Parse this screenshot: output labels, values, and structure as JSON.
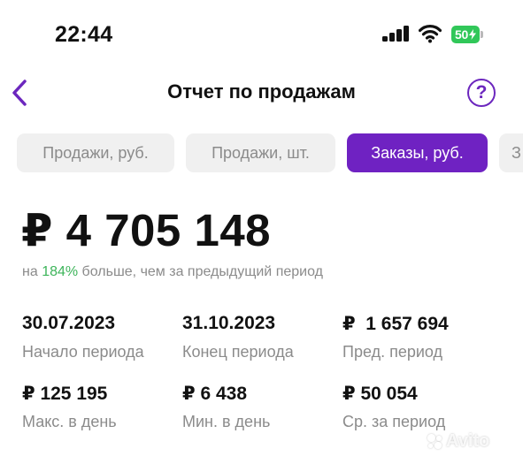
{
  "status_bar": {
    "time": "22:44",
    "battery_level": "50",
    "icons": [
      "signal-bars-icon",
      "wifi-icon",
      "battery-charging-icon"
    ]
  },
  "header": {
    "title": "Отчет по продажам",
    "back_icon": "chevron-left-icon",
    "help_label": "?",
    "accent_color": "#6c27be"
  },
  "tabs": [
    {
      "label": "Продажи, руб.",
      "active": false
    },
    {
      "label": "Продажи, шт.",
      "active": false
    },
    {
      "label": "Заказы, руб.",
      "active": true
    },
    {
      "label": "З",
      "active": false
    }
  ],
  "summary": {
    "total": "₽ 4 705 148",
    "compare_prefix": "на ",
    "compare_percent": "184%",
    "compare_suffix": " больше, чем за предыдущий период",
    "percent_color": "#3db45a"
  },
  "stats": [
    {
      "value": "30.07.2023",
      "caption": "Начало периода"
    },
    {
      "value": "31.10.2023",
      "caption": "Конец периода"
    },
    {
      "value": "₽  1 657 694",
      "caption": "Пред. период"
    },
    {
      "value": "₽ 125 195",
      "caption": "Макс. в день"
    },
    {
      "value": "₽ 6 438",
      "caption": "Мин. в день"
    },
    {
      "value": "₽ 50 054",
      "caption": "Ср. за период"
    }
  ],
  "watermark": "Avito"
}
